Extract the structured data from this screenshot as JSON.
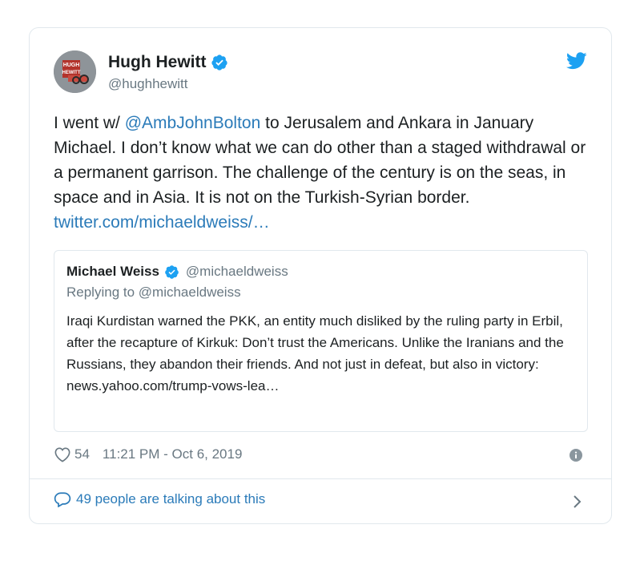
{
  "author": {
    "name": "Hugh Hewitt",
    "handle": "@hughhewitt",
    "avatar_text": "HUGH HEWITT"
  },
  "tweet": {
    "text_before": "I went w/ ",
    "mention": "@AmbJohnBolton",
    "text_after": " to Jerusalem and Ankara in January Michael. I don’t know what we can do other than a staged withdrawal or a permanent garrison. The challenge of the century is on the seas, in space and in Asia. It is not on the Turkish-Syrian border. ",
    "link": "twitter.com/michaeldweiss/…"
  },
  "quoted": {
    "name": "Michael Weiss",
    "handle": "@michaeldweiss",
    "reply": "Replying to @michaeldweiss",
    "text": "Iraqi Kurdistan warned the PKK, an entity much disliked by the ruling party in Erbil, after the recapture of Kirkuk: Don’t trust the Americans. Unlike the Iranians and the Russians, they abandon their friends. And not just in defeat, but also in victory: news.yahoo.com/trump-vows-lea…"
  },
  "meta": {
    "likes": "54",
    "timestamp": "11:21 PM - Oct 6, 2019"
  },
  "footer": {
    "talking": "49 people are talking about this"
  },
  "icons": {
    "verified": "verified-badge-icon",
    "twitter": "twitter-bird-icon",
    "heart": "heart-icon",
    "info": "info-icon",
    "comment": "comment-icon",
    "chevron": "chevron-right-icon"
  },
  "colors": {
    "link": "#2b7bb9",
    "verified": "#1da1f2",
    "muted": "#697882",
    "border": "#e1e8ed"
  }
}
